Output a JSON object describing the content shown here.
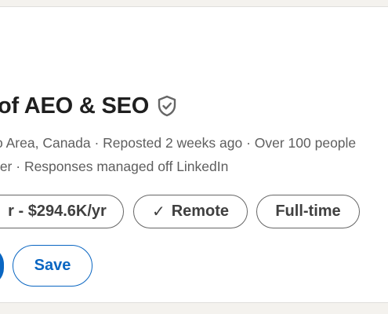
{
  "job": {
    "title": "of AEO & SEO",
    "meta_line_1": "o Area, Canada · Reposted 2 weeks ago · Over 100 people",
    "meta_line_2": "rer · Responses managed off LinkedIn"
  },
  "tags": {
    "salary": "r - $294.6K/yr",
    "remote_check": "✓",
    "remote": "Remote",
    "employment_type": "Full-time"
  },
  "actions": {
    "save_label": "Save"
  },
  "icons": {
    "verified": "shield-check-icon"
  },
  "colors": {
    "brand_blue": "#0a66c2",
    "text_primary": "#1f1f1f",
    "text_secondary": "#5e5e5e",
    "pill_border": "#666666"
  }
}
